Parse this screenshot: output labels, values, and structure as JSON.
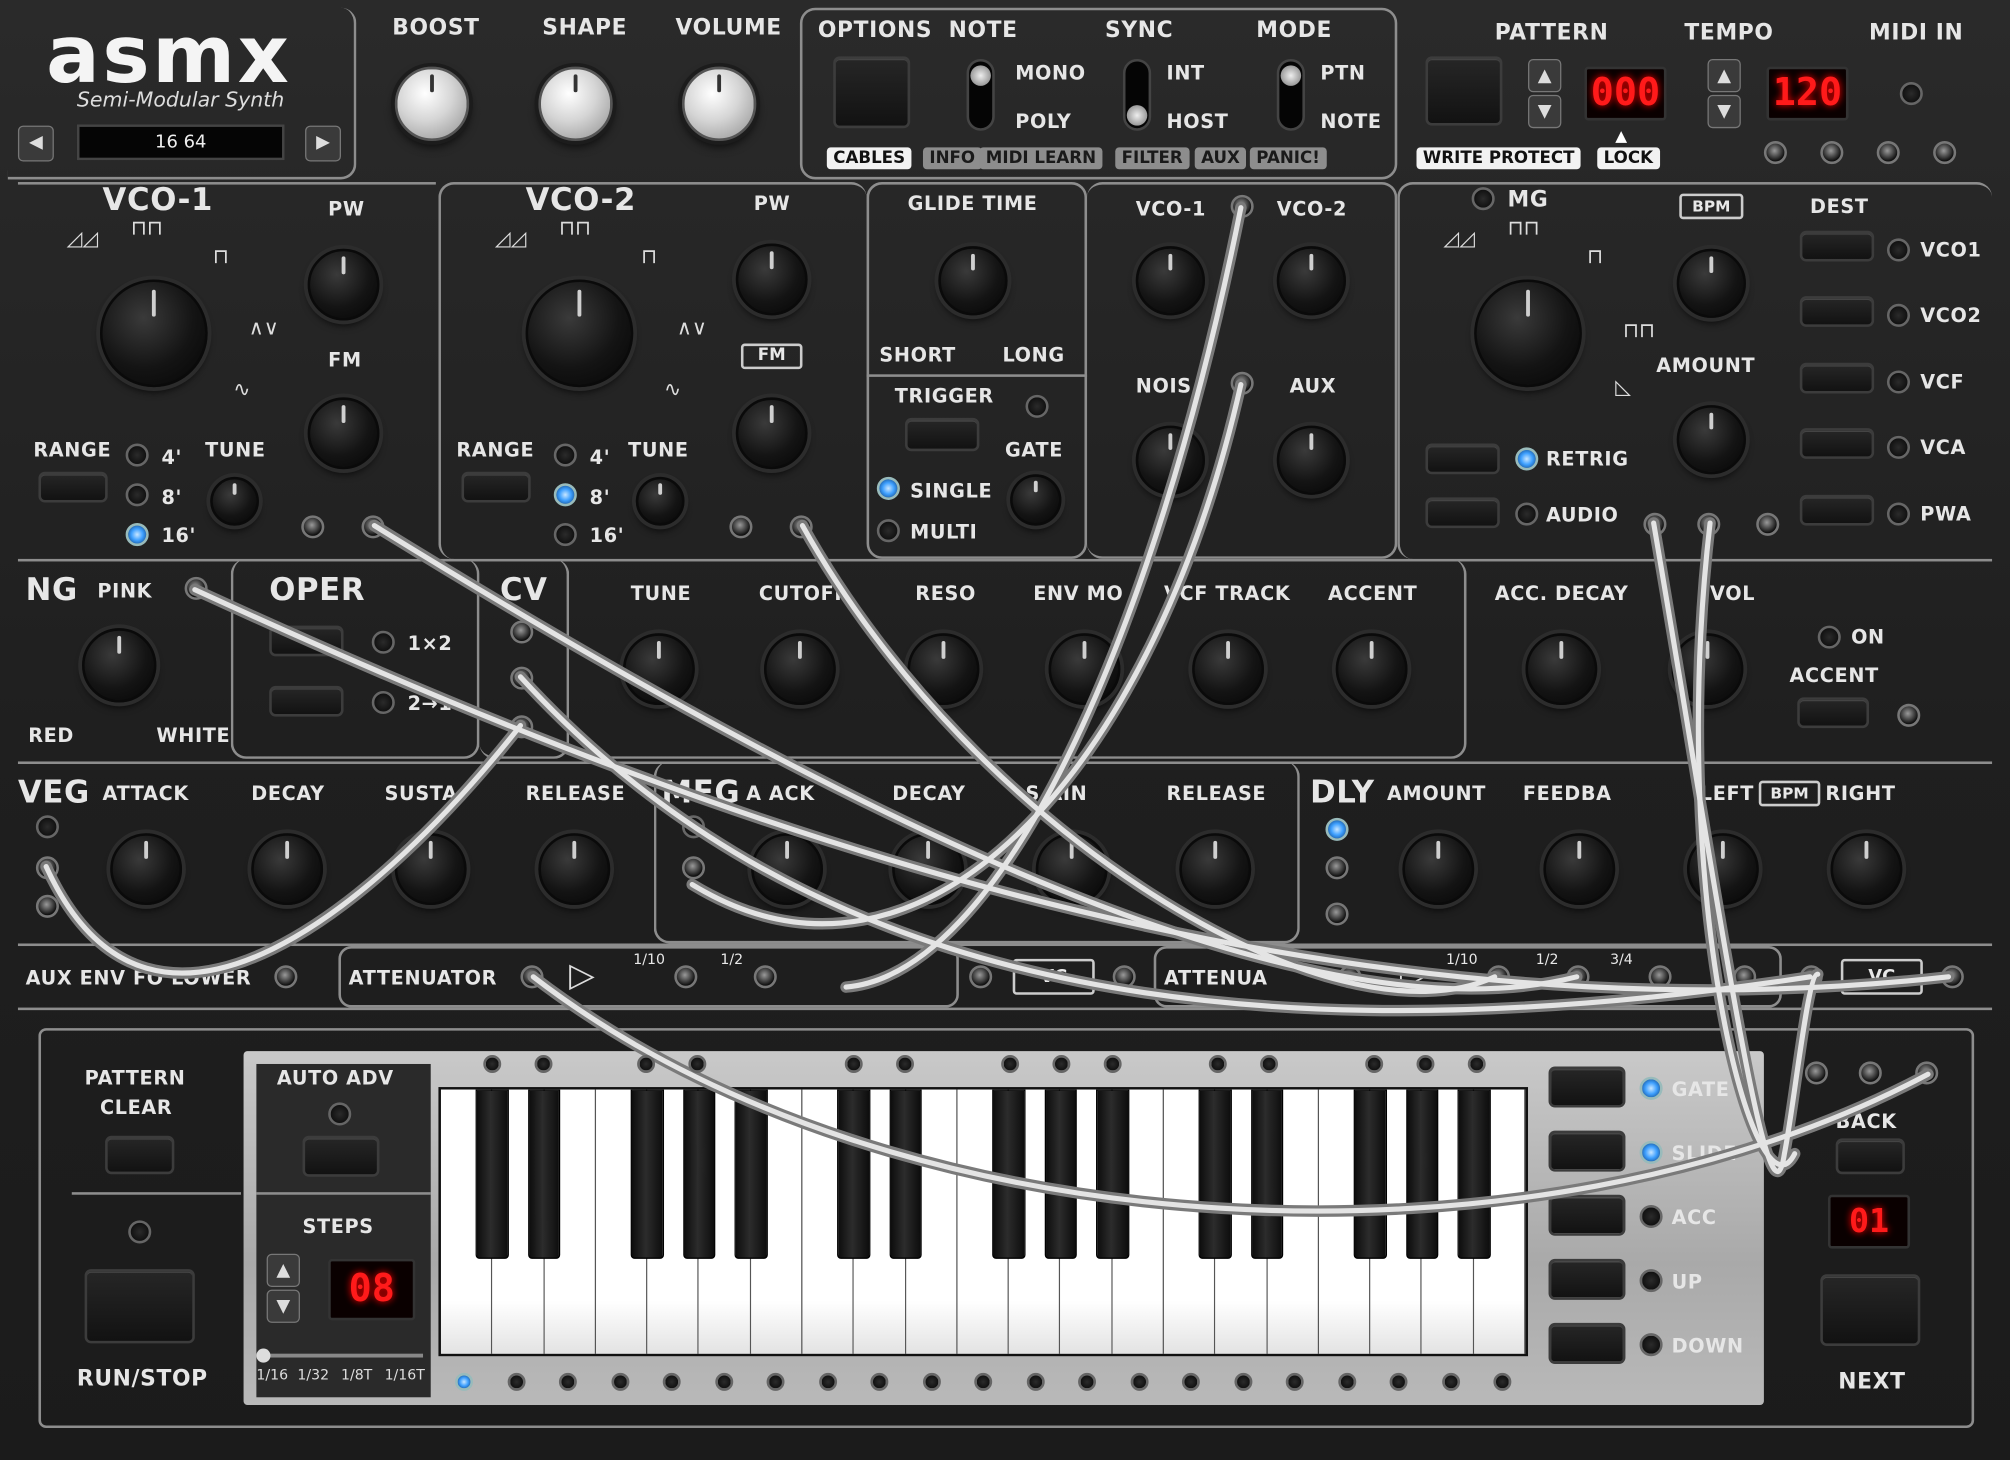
{
  "header": {
    "logo": "asmx",
    "subtitle": "Semi-Modular Synth",
    "preset_name": "16 64",
    "prev_label": "◀",
    "next_label": "▶"
  },
  "top_knobs": {
    "boost": "BOOST",
    "shape": "SHAPE",
    "volume": "VOLUME"
  },
  "options": {
    "title": "OPTIONS",
    "note": "NOTE",
    "mono": "MONO",
    "poly": "POLY",
    "sync": "SYNC",
    "int": "INT",
    "host": "HOST",
    "mode": "MODE",
    "ptn": "PTN",
    "note_mode": "NOTE",
    "tags": [
      "CABLES",
      "INFO",
      "MIDI LEARN",
      "FILTER",
      "AUX",
      "PANIC!"
    ]
  },
  "pattern": {
    "title": "PATTERN",
    "value": "000",
    "write_protect": "WRITE PROTECT",
    "lock": "LOCK"
  },
  "tempo": {
    "title": "TEMPO",
    "value": "120"
  },
  "midi_in": "MIDI IN",
  "vco1": {
    "title": "VCO-1",
    "pw": "PW",
    "fm": "FM",
    "range": "RANGE",
    "tune": "TUNE",
    "r4": "4'",
    "r8": "8'",
    "r16": "16'"
  },
  "vco2": {
    "title": "VCO-2",
    "pw": "PW",
    "fm": "FM",
    "range": "RANGE",
    "tune": "TUNE",
    "r4": "4'",
    "r8": "8'",
    "r16": "16'"
  },
  "glide": {
    "title": "GLIDE TIME",
    "short": "SHORT",
    "long": "LONG",
    "trigger": "TRIGGER",
    "gate": "GATE",
    "single": "SINGLE",
    "multi": "MULTI"
  },
  "mixer": {
    "vco1": "VCO-1",
    "vco2": "VCO-2",
    "noise": "NOIS",
    "aux": "AUX"
  },
  "mg": {
    "title": "MG",
    "bpm": "BPM",
    "dest": "DEST",
    "amount": "AMOUNT",
    "retrig": "RETRIG",
    "audio": "AUDIO",
    "dests": [
      "VCO1",
      "VCO2",
      "VCF",
      "VCA",
      "PWA"
    ]
  },
  "ng": {
    "title": "NG",
    "pink": "PINK",
    "red": "RED",
    "white": "WHITE"
  },
  "oper": {
    "title": "OPER",
    "op1": "1×2",
    "op2": "2→1"
  },
  "cv": "CV",
  "filter": {
    "tune": "TUNE",
    "cutoff": "CUTOFF",
    "reso": "RESO",
    "env_mod": "ENV MO",
    "vcf_track": "VCF TRACK",
    "accent": "ACCENT"
  },
  "acc": {
    "decay": "ACC. DECAY",
    "vol": "VOL",
    "on": "ON",
    "accent": "ACCENT"
  },
  "veg": {
    "title": "VEG",
    "attack": "ATTACK",
    "decay": "DECAY",
    "sustain": "SUSTA",
    "release": "RELEASE"
  },
  "meg": {
    "title": "MEG",
    "attack": "A  ACK",
    "decay": "DECAY",
    "sustain": "S    AIN",
    "release": "RELEASE"
  },
  "dly": {
    "title": "DLY",
    "amount": "AMOUNT",
    "feedback": "FEEDBA",
    "left": "LEFT",
    "bpm": "BPM",
    "right": "RIGHT"
  },
  "utility": {
    "aux_env": "AUX ENV FO  LOWER",
    "attenuator": "ATTENUATOR",
    "attenuator2": "ATTENUA",
    "ratio1": "1/10",
    "ratio2": "1/2",
    "ratio3": "3/4",
    "vc": "VC"
  },
  "sequencer": {
    "pattern_clear": [
      "PATTERN",
      "CLEAR"
    ],
    "run_stop": "RUN/STOP",
    "auto_adv": "AUTO ADV",
    "steps": "STEPS",
    "steps_value": "08",
    "divisions": [
      "1/16",
      "1/32",
      "1/8T",
      "1/16T"
    ],
    "gate": "GATE",
    "slide": "SLIDE",
    "acc": "ACC",
    "up": "UP",
    "down": "DOWN",
    "back": "BACK",
    "next": "NEXT",
    "step_value": "01"
  },
  "colors": {
    "lcd_red": "#ff1a1a",
    "led_blue": "#3ea0ff",
    "panel_line": "#8d8d8d"
  }
}
